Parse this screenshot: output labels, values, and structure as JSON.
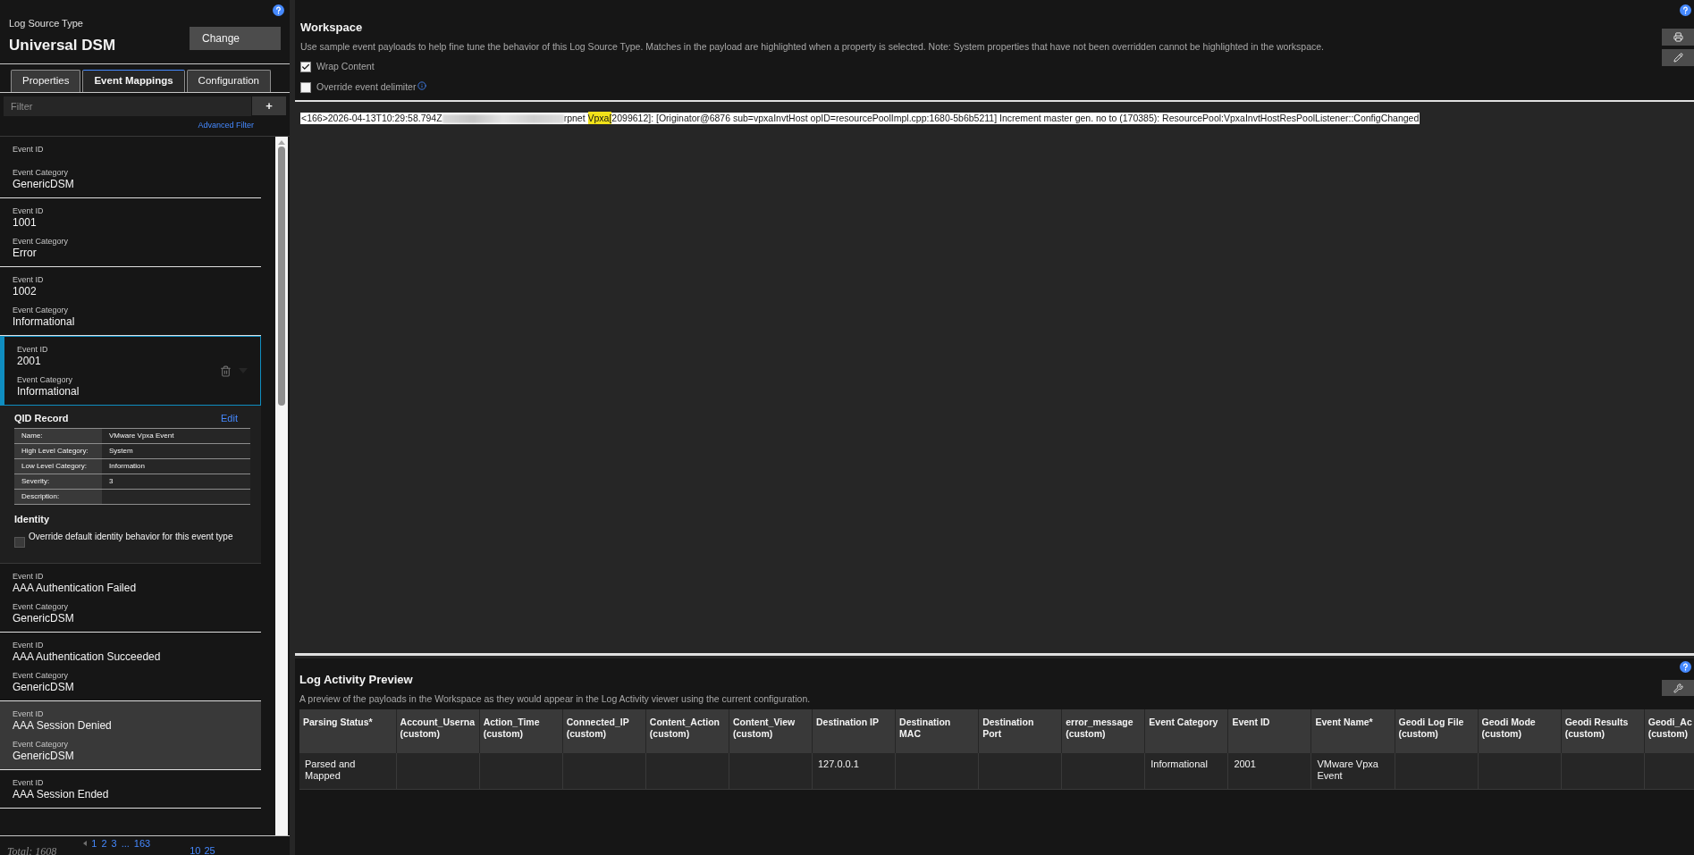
{
  "log_source": {
    "label": "Log Source Type",
    "name": "Universal DSM",
    "change_button": "Change"
  },
  "tabs": [
    {
      "label": "Properties",
      "selected": false
    },
    {
      "label": "Event Mappings",
      "selected": true
    },
    {
      "label": "Configuration",
      "selected": false
    }
  ],
  "filter": {
    "placeholder": "Filter",
    "add_button": "+",
    "advanced_link": "Advanced Filter"
  },
  "mappings": [
    {
      "id_label": "Event ID",
      "category_label": "Event Category",
      "category": "GenericDSM",
      "selected": false,
      "hovered": false
    },
    {
      "id_label": "Event ID",
      "event_id": "1001",
      "category_label": "Event Category",
      "category": "Error",
      "selected": false,
      "hovered": false
    },
    {
      "id_label": "Event ID",
      "event_id": "1002",
      "category_label": "Event Category",
      "category": "Informational",
      "selected": false,
      "hovered": false
    },
    {
      "id_label": "Event ID",
      "event_id": "2001",
      "category_label": "Event Category",
      "category": "Informational",
      "selected": true,
      "hovered": false,
      "qid_record": {
        "title": "QID Record",
        "edit_link": "Edit",
        "fields": [
          {
            "label": "Name:",
            "value": "VMware Vpxa Event"
          },
          {
            "label": "High Level Category:",
            "value": "System"
          },
          {
            "label": "Low Level Category:",
            "value": "Information"
          },
          {
            "label": "Severity:",
            "value": "3"
          },
          {
            "label": "Description:"
          }
        ]
      },
      "identity": {
        "title": "Identity",
        "override_label": "Override default identity behavior for this event type",
        "checked": false
      }
    },
    {
      "id_label": "Event ID",
      "event_id": "AAA Authentication Failed",
      "category_label": "Event Category",
      "category": "GenericDSM",
      "selected": false,
      "hovered": false
    },
    {
      "id_label": "Event ID",
      "event_id": "AAA Authentication Succeeded",
      "category_label": "Event Category",
      "category": "GenericDSM",
      "selected": false,
      "hovered": false
    },
    {
      "id_label": "Event ID",
      "event_id": "AAA Session Denied",
      "category_label": "Event Category",
      "category": "GenericDSM",
      "selected": false,
      "hovered": true
    },
    {
      "id_label": "Event ID",
      "event_id": "AAA Session Ended",
      "selected": false,
      "hovered": false
    }
  ],
  "pagination": {
    "total": "Total: 1608",
    "pages": [
      "1",
      "2",
      "3",
      "...",
      "163"
    ],
    "page_sizes": [
      "10",
      "25"
    ]
  },
  "workspace": {
    "title": "Workspace",
    "description": "Use sample event payloads to help fine tune the behavior of this Log Source Type. Matches in the payload are highlighted when a property is selected. Note: System properties that have not been overridden cannot be highlighted in the workspace.",
    "options": [
      {
        "label": "Wrap Content",
        "checked": true,
        "info": false
      },
      {
        "label": "Override event delimiter",
        "checked": false,
        "info": true
      }
    ],
    "payload": [
      {
        "kind": "text",
        "text": "<166>2026-04-13T10:29:58.794Z"
      },
      {
        "kind": "redacted"
      },
      {
        "kind": "text",
        "text": "rpnet "
      },
      {
        "kind": "highlight",
        "text": "Vpxa["
      },
      {
        "kind": "text",
        "text": "2099612]: [Originator@6876 sub=vpxaInvtHost opID=resourcePoolImpl.cpp:1680-5b6b5211] Increment master gen. no to (170385): ResourcePool:VpxaInvtHostResPoolListener::ConfigChanged"
      }
    ]
  },
  "preview": {
    "title": "Log Activity Preview",
    "description": "A preview of the payloads in the Workspace as they would appear in the Log Activity viewer using the current configuration.",
    "columns": [
      {
        "lines": [
          "Parsing Status*"
        ]
      },
      {
        "lines": [
          "Account_Userna",
          "(custom)"
        ]
      },
      {
        "lines": [
          "Action_Time",
          "(custom)"
        ]
      },
      {
        "lines": [
          "Connected_IP",
          "(custom)"
        ]
      },
      {
        "lines": [
          "Content_Action",
          "(custom)"
        ]
      },
      {
        "lines": [
          "Content_View",
          "(custom)"
        ]
      },
      {
        "lines": [
          "Destination IP"
        ]
      },
      {
        "lines": [
          "Destination",
          "MAC"
        ]
      },
      {
        "lines": [
          "Destination",
          "Port"
        ]
      },
      {
        "lines": [
          "error_message",
          "(custom)"
        ]
      },
      {
        "lines": [
          "Event Category"
        ]
      },
      {
        "lines": [
          "Event ID"
        ]
      },
      {
        "lines": [
          "Event Name*"
        ]
      },
      {
        "lines": [
          "Geodi Log File",
          "(custom)"
        ]
      },
      {
        "lines": [
          "Geodi Mode",
          "(custom)"
        ]
      },
      {
        "lines": [
          "Geodi Results",
          "(custom)"
        ]
      },
      {
        "lines": [
          "Geodi_Ac",
          "(custom)"
        ]
      }
    ],
    "rows": [
      {
        "cells": [
          "Parsed and Mapped",
          null,
          null,
          null,
          null,
          null,
          "127.0.0.1",
          null,
          null,
          null,
          "Informational",
          "2001",
          "VMware Vpxa Event",
          null,
          null,
          null,
          null
        ]
      }
    ]
  }
}
